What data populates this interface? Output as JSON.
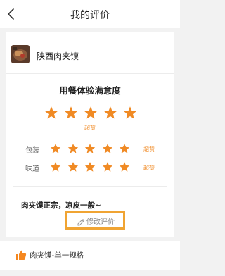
{
  "header": {
    "title": "我的评价"
  },
  "shop": {
    "name": "陕西肉夹馍"
  },
  "rating": {
    "heading": "用餐体验满意度",
    "overall": {
      "stars": 5,
      "max": 5,
      "text": "超赞"
    },
    "items": [
      {
        "label": "包装",
        "stars": 5,
        "max": 5,
        "text": "超赞"
      },
      {
        "label": "味道",
        "stars": 5,
        "max": 5,
        "text": "超赞"
      }
    ]
  },
  "review": {
    "text": "肉夹馍正宗，凉皮一般~"
  },
  "edit": {
    "label": "修改评价",
    "icon": "edit-icon"
  },
  "liked_item": {
    "label": "肉夹馍-单一规格",
    "icon": "thumbs-up-icon"
  },
  "colors": {
    "star": "#f08a24",
    "highlight_border": "#f0a433",
    "thumb_up": "#f5871f"
  }
}
